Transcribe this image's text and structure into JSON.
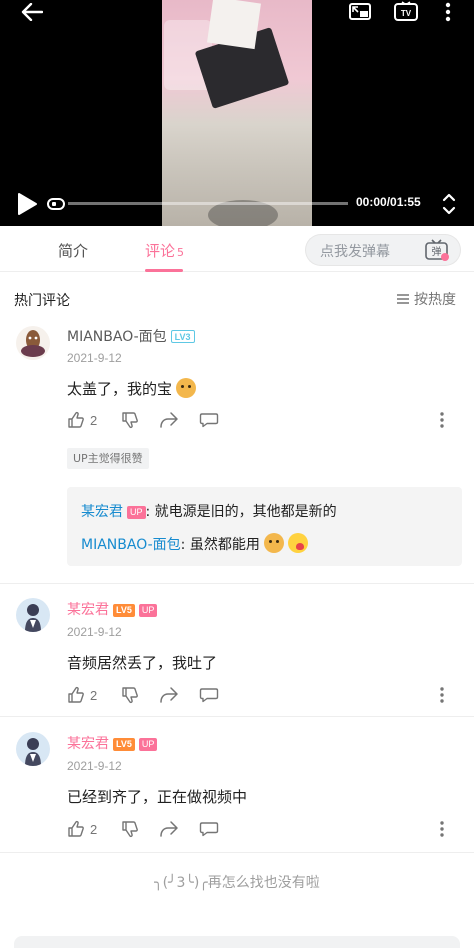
{
  "player": {
    "time": "00:00/01:55",
    "progress_fraction": 0.0,
    "icons": [
      "back-arrow-icon",
      "picture-in-picture-icon",
      "tv-cast-icon",
      "more-vertical-icon",
      "play-icon",
      "danmaku-toggle-icon",
      "fullscreen-icon"
    ]
  },
  "tabs": {
    "intro": "简介",
    "comments": "评论",
    "comments_count": "5"
  },
  "danmaku": {
    "placeholder": "点我发弹幕",
    "toggle_label": "弹"
  },
  "comments_header": {
    "title": "热门评论",
    "sort_label": "按热度"
  },
  "comments": [
    {
      "user": "MIANBAO-面包",
      "level": "LV3",
      "date": "2021-9-12",
      "text": "太盖了，我的宝",
      "likes": "2",
      "up_liked": "UP主觉得很赞",
      "replies": [
        {
          "user": "某宏君",
          "tag": "UP",
          "text": ": 就电源是旧的，其他都是新的"
        },
        {
          "user": "MIANBAO-面包",
          "text": ": 虽然都能用"
        }
      ]
    },
    {
      "user": "某宏君",
      "level": "LV5",
      "tag": "UP",
      "date": "2021-9-12",
      "text": "音频居然丢了，我吐了",
      "likes": "2"
    },
    {
      "user": "某宏君",
      "level": "LV5",
      "tag": "UP",
      "date": "2021-9-12",
      "text": "已经到齐了，正在做视频中",
      "likes": "2"
    }
  ],
  "end_note": "╮(╯3╰)╭再怎么找也没有啦",
  "colors": {
    "accent_pink": "#fb7299",
    "reply_blue": "#178bcf",
    "level3": "#5ec8e4",
    "level5": "#ff8c38"
  }
}
